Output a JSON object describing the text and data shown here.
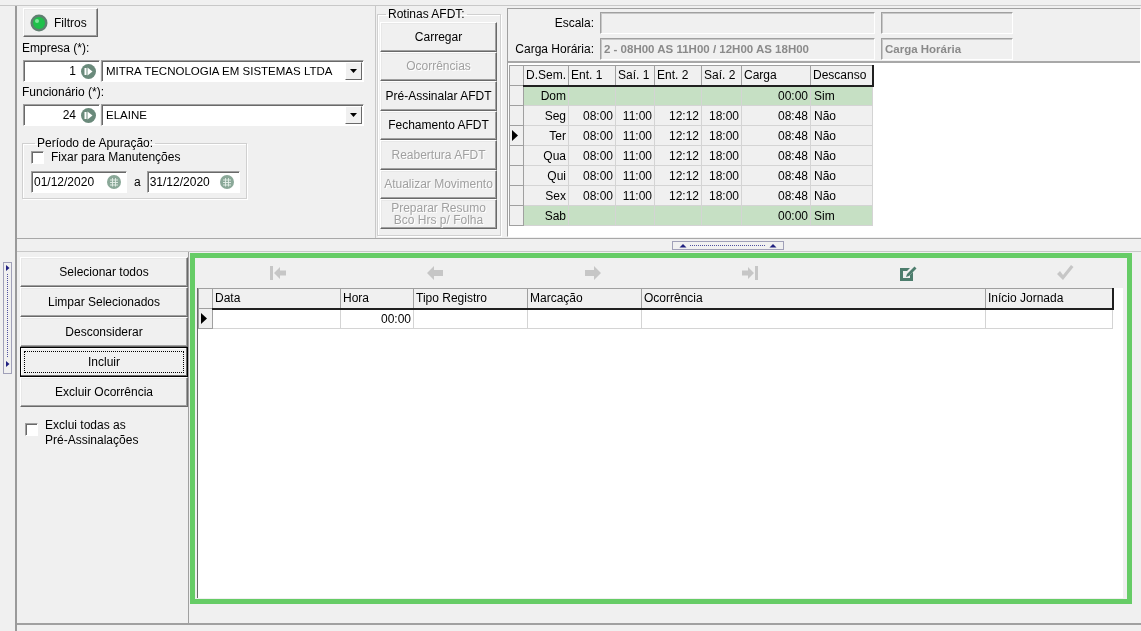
{
  "filters_button": {
    "label": "Filtros"
  },
  "company": {
    "label": "Empresa (*):",
    "code": "1",
    "name": "MITRA TECNOLOGIA EM SISTEMAS LTDA"
  },
  "employee": {
    "label": "Funcionário (*):",
    "code": "24",
    "name": "ELAINE"
  },
  "period": {
    "title": "Período de Apuração:",
    "lock": {
      "label": "Fixar para Manutenções",
      "checked": false
    },
    "start": "01/12/2020",
    "separator": "a",
    "end": "31/12/2020"
  },
  "routines": {
    "title": "Rotinas AFDT:",
    "buttons": [
      {
        "label": "Carregar",
        "disabled": false
      },
      {
        "label": "Ocorrências",
        "disabled": true
      },
      {
        "label": "Pré-Assinalar AFDT",
        "disabled": false
      },
      {
        "label": "Fechamento AFDT",
        "disabled": false
      },
      {
        "label": "Reabertura AFDT",
        "disabled": true
      },
      {
        "label": "Atualizar Movimento",
        "disabled": true
      },
      {
        "label": "Preparar Resumo Bco Hrs p/ Folha",
        "disabled": true
      }
    ]
  },
  "schedule": {
    "scale": {
      "label": "Escala:",
      "disabled": true
    },
    "workload": {
      "label": "Carga Horária:",
      "value": "2 - 08H00 AS 11H00 / 12H00 AS 18H00",
      "side_value": "Carga Horária",
      "disabled": true
    },
    "columns": [
      "D.Sem.",
      "Ent. 1",
      "Saí. 1",
      "Ent. 2",
      "Saí. 2",
      "Carga",
      "Descanso"
    ],
    "rows": [
      {
        "cells": [
          "Dom",
          null,
          null,
          null,
          null,
          "00:00",
          "Sim"
        ],
        "selected": false,
        "highlighted": true
      },
      {
        "cells": [
          "Seg",
          "08:00",
          "11:00",
          "12:12",
          "18:00",
          "08:48",
          "Não"
        ],
        "selected": false,
        "highlighted": false
      },
      {
        "cells": [
          "Ter",
          "08:00",
          "11:00",
          "12:12",
          "18:00",
          "08:48",
          "Não"
        ],
        "selected": true,
        "highlighted": false
      },
      {
        "cells": [
          "Qua",
          "08:00",
          "11:00",
          "12:12",
          "18:00",
          "08:48",
          "Não"
        ],
        "selected": false,
        "highlighted": false
      },
      {
        "cells": [
          "Qui",
          "08:00",
          "11:00",
          "12:12",
          "18:00",
          "08:48",
          "Não"
        ],
        "selected": false,
        "highlighted": false
      },
      {
        "cells": [
          "Sex",
          "08:00",
          "11:00",
          "12:12",
          "18:00",
          "08:48",
          "Não"
        ],
        "selected": false,
        "highlighted": false
      },
      {
        "cells": [
          "Sab",
          null,
          null,
          null,
          null,
          "00:00",
          "Sim"
        ],
        "selected": false,
        "highlighted": true
      }
    ]
  },
  "actions": [
    {
      "label": "Selecionar todos",
      "focused": false
    },
    {
      "label": "Limpar Selecionados",
      "focused": false
    },
    {
      "label": "Desconsiderar",
      "focused": false
    },
    {
      "label": "Incluir",
      "focused": true
    },
    {
      "label": "Excluir Ocorrência",
      "focused": false
    }
  ],
  "delete_all": {
    "label": "Exclui todas as Pré-Assinalações",
    "checked": false
  },
  "toolbar": [
    {
      "kind": "first",
      "disabled": true
    },
    {
      "kind": "prev",
      "disabled": true
    },
    {
      "kind": "next",
      "disabled": true
    },
    {
      "kind": "last",
      "disabled": true
    },
    {
      "kind": "edit",
      "disabled": false
    },
    {
      "kind": "confirm",
      "disabled": true
    }
  ],
  "records": {
    "columns": [
      "Data",
      "Hora",
      "Tipo Registro",
      "Marcação",
      "Ocorrência",
      "Início Jornada"
    ],
    "rows": [
      {
        "cells": [
          null,
          "00:00",
          null,
          null,
          null,
          null
        ],
        "selected": true
      }
    ]
  }
}
